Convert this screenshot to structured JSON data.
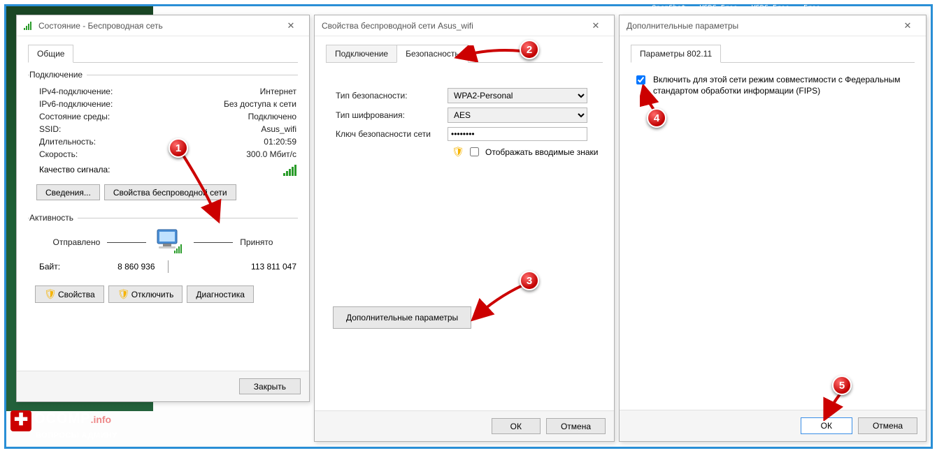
{
  "desktop": {
    "icons": [
      "OpenShot",
      "VSDC Free",
      "VSDC Free",
      "Free..."
    ]
  },
  "watermark": {
    "brand": "OCOMP",
    "suffix": ".info",
    "subtitle": "ВОПРОСЫ АДМИНУ"
  },
  "win1": {
    "title": "Состояние - Беспроводная сеть",
    "tab_general": "Общие",
    "group_connection": "Подключение",
    "ipv4_label": "IPv4-подключение:",
    "ipv4_value": "Интернет",
    "ipv6_label": "IPv6-подключение:",
    "ipv6_value": "Без доступа к сети",
    "media_label": "Состояние среды:",
    "media_value": "Подключено",
    "ssid_label": "SSID:",
    "ssid_value": "Asus_wifi",
    "duration_label": "Длительность:",
    "duration_value": "01:20:59",
    "speed_label": "Скорость:",
    "speed_value": "300.0 Мбит/с",
    "signal_label": "Качество сигнала:",
    "details_btn": "Сведения...",
    "wprops_btn": "Свойства беспроводной сети",
    "group_activity": "Активность",
    "sent_label": "Отправлено",
    "recv_label": "Принято",
    "bytes_label": "Байт:",
    "bytes_sent": "8 860 936",
    "bytes_recv": "113 811 047",
    "props_btn": "Свойства",
    "disable_btn": "Отключить",
    "diag_btn": "Диагностика",
    "close_btn": "Закрыть"
  },
  "win2": {
    "title": "Свойства беспроводной сети Asus_wifi",
    "tab_connection": "Подключение",
    "tab_security": "Безопасность",
    "sec_type_label": "Тип безопасности:",
    "sec_type_value": "WPA2-Personal",
    "enc_type_label": "Тип шифрования:",
    "enc_type_value": "AES",
    "key_label": "Ключ безопасности сети",
    "key_value": "••••••••",
    "show_chars": "Отображать вводимые знаки",
    "adv_btn": "Дополнительные параметры",
    "ok": "ОК",
    "cancel": "Отмена"
  },
  "win3": {
    "title": "Дополнительные параметры",
    "tab_80211": "Параметры 802.11",
    "fips_label": "Включить для этой сети режим совместимости с Федеральным стандартом обработки информации (FIPS)",
    "ok": "ОК",
    "cancel": "Отмена"
  },
  "badges": {
    "b1": "1",
    "b2": "2",
    "b3": "3",
    "b4": "4",
    "b5": "5"
  }
}
